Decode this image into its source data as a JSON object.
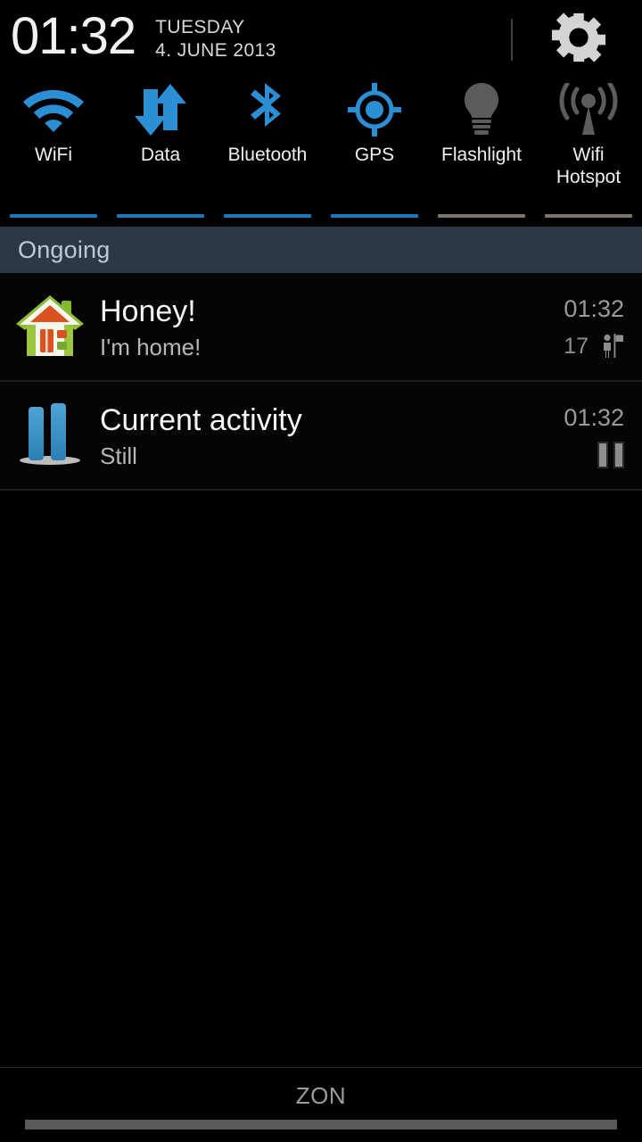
{
  "statusbar": {
    "time": "01:32",
    "day": "TUESDAY",
    "date": "4. JUNE 2013",
    "settings_icon": "gear-icon",
    "divider": "status-divider"
  },
  "toggles": [
    {
      "id": "wifi",
      "label": "WiFi",
      "icon": "wifi-icon",
      "active": true,
      "underline_color": "#1878b8"
    },
    {
      "id": "data",
      "label": "Data",
      "icon": "data-arrows-icon",
      "active": true,
      "underline_color": "#1878b8"
    },
    {
      "id": "bluetooth",
      "label": "Bluetooth",
      "icon": "bluetooth-icon",
      "active": true,
      "underline_color": "#1878b8"
    },
    {
      "id": "gps",
      "label": "GPS",
      "icon": "gps-crosshair-icon",
      "active": true,
      "underline_color": "#1878b8"
    },
    {
      "id": "flashlight",
      "label": "Flashlight",
      "icon": "lightbulb-icon",
      "active": false,
      "underline_color": "#7a756b"
    },
    {
      "id": "hotspot",
      "label": "Wifi\nHotspot",
      "icon": "broadcast-tower-icon",
      "active": false,
      "underline_color": "#7a756b"
    }
  ],
  "section": {
    "title": "Ongoing",
    "background": "#2b3946",
    "text_color": "#b9cbd8"
  },
  "notifications": [
    {
      "id": "honey",
      "icon": "house-icon",
      "title": "Honey!",
      "text": "I'm home!",
      "time": "01:32",
      "count": "17",
      "sub_icon": "person-with-flag-icon"
    },
    {
      "id": "current-activity",
      "icon": "blue-bars-icon",
      "title": "Current activity",
      "text": "Still",
      "time": "01:32",
      "count": "",
      "sub_icon": "pause-icon"
    }
  ],
  "bottom": {
    "carrier": "ZON",
    "handle": "drag-handle"
  },
  "colors": {
    "accent_blue": "#1878b8",
    "icon_blue": "#2a8fd4",
    "inactive_gray": "#7a756b",
    "background": "#000000"
  }
}
